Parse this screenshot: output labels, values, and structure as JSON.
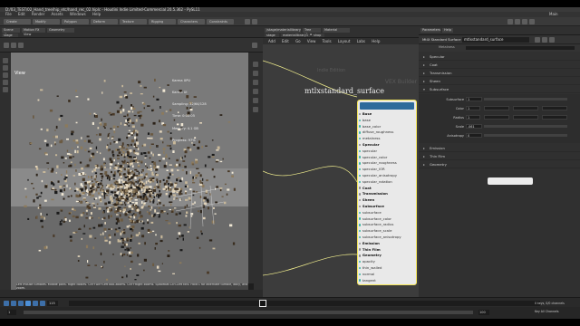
{
  "app": {
    "title": "D:/03_TEST/02_Hand_tree/hip_etc/hand_rec_02.hiplc - Houdini Indie Limited-Commercial 20.5.362 - PySL11",
    "menu": [
      "File",
      "Edit",
      "Render",
      "Assets",
      "Windows",
      "Help"
    ],
    "desktop": "Main"
  },
  "shelf_tabs": [
    "Create",
    "Modify",
    "Polygon",
    "Deform",
    "Texture",
    "Rigging",
    "Characters",
    "Constraints"
  ],
  "viewport": {
    "tabs": [
      "Scene View",
      "Motion FX View",
      "Geometry Spreadsheet"
    ],
    "path": "stage",
    "label": "View",
    "info_lines": [
      "Karma XPU",
      "Karma UI",
      "Sampling: 32/64/128",
      "Time: 0:00:05",
      "Memory: 4.1 GB",
      "Progress: 97%"
    ],
    "status": "Left mouse tumbles. Middle pans. Right dollies. Ctrl+Alt+Left box-zooms. Ctrl+Right zooms. Spacebar-Ctrl-Left tilts. Hold L for alternate tumble, dolly, and zoom."
  },
  "network": {
    "tabs": [
      "/stage/materiallibrary1/mtlx...",
      "Tree View",
      "Material Palette"
    ],
    "path": [
      "stage",
      "materiallibrary1",
      "shop"
    ],
    "menu": [
      "Add",
      "Edit",
      "Go",
      "View",
      "Tools",
      "Layout",
      "Labs",
      "Help"
    ],
    "bg_title": "VEX Builder",
    "bg_title2": "Indie Edition",
    "node_name": "mtlxstandard_surface",
    "ports": [
      {
        "label": "Base",
        "header": true
      },
      {
        "label": "base"
      },
      {
        "label": "base_color"
      },
      {
        "label": "diffuse_roughness"
      },
      {
        "label": "metalness"
      },
      {
        "label": "Specular",
        "header": true
      },
      {
        "label": "specular"
      },
      {
        "label": "specular_color"
      },
      {
        "label": "specular_roughness"
      },
      {
        "label": "specular_IOR"
      },
      {
        "label": "specular_anisotropy"
      },
      {
        "label": "specular_rotation"
      },
      {
        "label": "Coat",
        "header": true
      },
      {
        "label": "Transmission",
        "header": true
      },
      {
        "label": "Sheen",
        "header": true
      },
      {
        "label": "Subsurface",
        "header": true
      },
      {
        "label": "subsurface"
      },
      {
        "label": "subsurface_color"
      },
      {
        "label": "subsurface_radius"
      },
      {
        "label": "subsurface_scale"
      },
      {
        "label": "subsurface_anisotropy"
      },
      {
        "label": "Emission",
        "header": true
      },
      {
        "label": "Thin Film",
        "header": true
      },
      {
        "label": "Geometry",
        "header": true
      },
      {
        "label": "opacity"
      },
      {
        "label": "thin_walled"
      },
      {
        "label": "normal"
      },
      {
        "label": "tangent"
      }
    ]
  },
  "params": {
    "tabs": [
      "Parameters",
      "Help"
    ],
    "node_type": "MtlX Standard Surface",
    "node_name": "mtlxstandard_surface",
    "top_row": "Metalness",
    "sections": [
      "Specular",
      "Coat",
      "Transmission",
      "Sheen",
      "Subsurface",
      "Emission",
      "Thin Film",
      "Geometry"
    ],
    "subsurface": {
      "rows": [
        {
          "label": "Subsurface",
          "value": "1"
        },
        {
          "label": "Color",
          "value": "1"
        },
        {
          "label": "Radius",
          "value": "1"
        },
        {
          "label": "Scale",
          "value": ".061"
        },
        {
          "label": "Anisotropy",
          "value": "0"
        }
      ]
    }
  },
  "timeline": {
    "start": "1",
    "end": "100",
    "frame": "115",
    "current_marker": "117",
    "keys_label": "0 keys, 0/0 channels",
    "key_menu": "Key All Channels",
    "realtime": "Auto Update"
  }
}
